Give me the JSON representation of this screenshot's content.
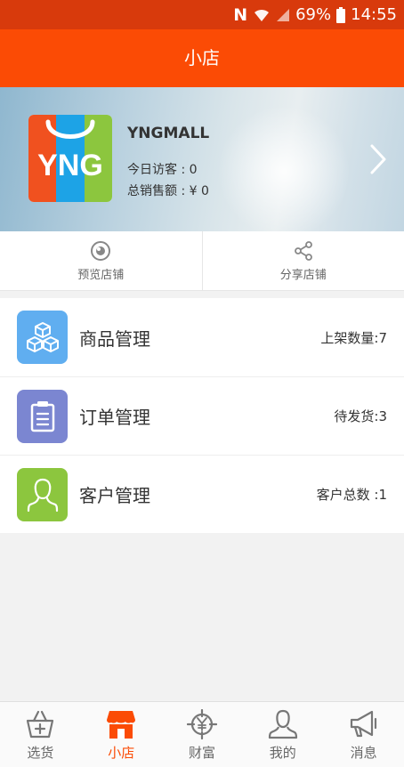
{
  "status_bar": {
    "nfc": "N",
    "battery": "69%",
    "time": "14:55"
  },
  "app_bar": {
    "title": "小店"
  },
  "store": {
    "logo_text": "YNG",
    "name": "YNGMALL",
    "visitors": "今日访客 : 0",
    "sales": "总销售额 : ¥ 0"
  },
  "actions": [
    {
      "label": "预览店铺",
      "icon": "eye-icon"
    },
    {
      "label": "分享店铺",
      "icon": "share-icon"
    }
  ],
  "menu": [
    {
      "label": "商品管理",
      "value": "上架数量:7",
      "icon": "boxes-icon",
      "color": "#60aef0"
    },
    {
      "label": "订单管理",
      "value": "待发货:3",
      "icon": "clipboard-icon",
      "color": "#7b86d1"
    },
    {
      "label": "客户管理",
      "value": "客户总数 :1",
      "icon": "person-icon",
      "color": "#8cc63e"
    }
  ],
  "tabs": [
    {
      "label": "选货",
      "icon": "basket-icon",
      "active": false
    },
    {
      "label": "小店",
      "icon": "shop-icon",
      "active": true
    },
    {
      "label": "财富",
      "icon": "yuan-target-icon",
      "active": false
    },
    {
      "label": "我的",
      "icon": "user-icon",
      "active": false
    },
    {
      "label": "消息",
      "icon": "megaphone-icon",
      "active": false
    }
  ],
  "colors": {
    "status_bar": "#d83a0c",
    "app_bar": "#fb4b05",
    "accent": "#fb4b05"
  }
}
